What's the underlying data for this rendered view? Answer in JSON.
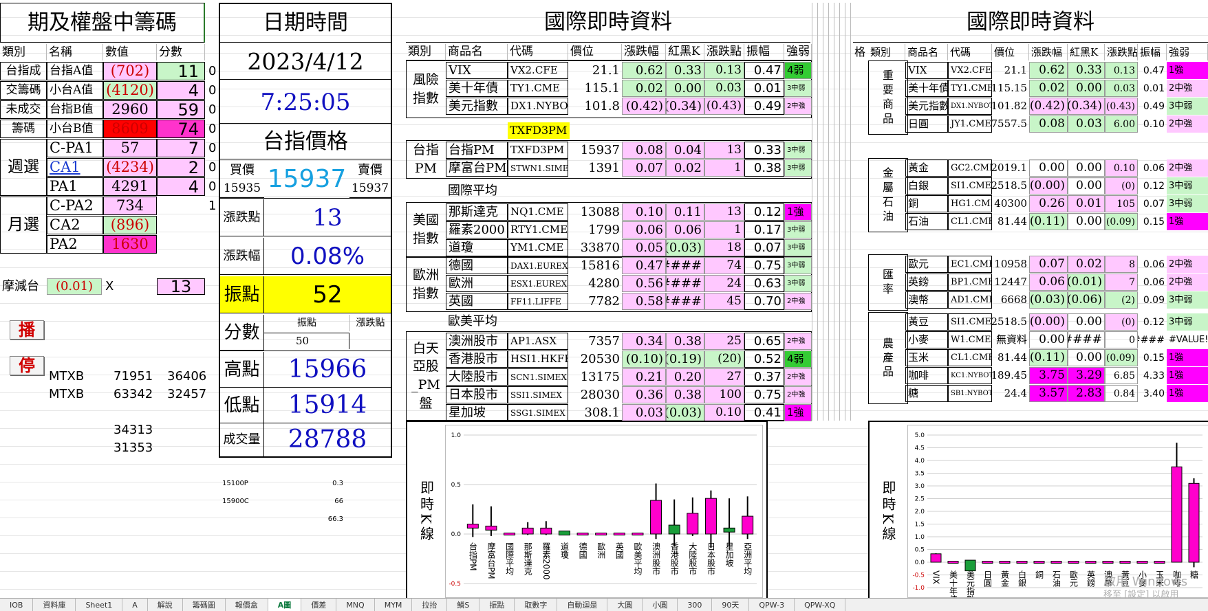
{
  "left": {
    "title": "期及權盤中籌碼",
    "headers": [
      "類別",
      "名稱",
      "數值",
      "分數"
    ],
    "rows": [
      {
        "cat": "台指成",
        "name": "台指A值",
        "val": "(702)",
        "score": "11",
        "extra": "0"
      },
      {
        "cat": "交籌碼",
        "name": "小台A值",
        "val": "(4120)",
        "score": "4",
        "extra": "0"
      },
      {
        "cat": "未成交",
        "name": "台指B值",
        "val": "2960",
        "score": "59",
        "extra": "0"
      },
      {
        "cat": "籌碼",
        "name": "小台B值",
        "val": "8609",
        "score": "74",
        "extra": "0"
      },
      {
        "cat": "",
        "name": "C-PA1",
        "val": "57",
        "score": "7",
        "extra": "0"
      },
      {
        "cat": "週選",
        "name": "CA1",
        "val": "(4234)",
        "score": "2",
        "extra": "0"
      },
      {
        "cat": "",
        "name": "PA1",
        "val": "4291",
        "score": "4",
        "extra": "0"
      },
      {
        "cat": "",
        "name": "C-PA2",
        "val": "734",
        "score": "",
        "extra": "1"
      },
      {
        "cat": "月選",
        "name": "CA2",
        "val": "(896)",
        "score": "",
        "extra": ""
      },
      {
        "cat": "",
        "name": "PA2",
        "val": "1630",
        "score": "",
        "extra": ""
      }
    ],
    "decay_label": "摩減台",
    "decay_val": "(0.01)",
    "decay_x": "X",
    "decay_score": "13",
    "play_btn": "播",
    "stop_btn": "停",
    "mtx": [
      {
        "name": "MTXB",
        "a": "71951",
        "b": "36406"
      },
      {
        "name": "MTXB",
        "a": "63342",
        "b": "32457"
      },
      {
        "name": "",
        "a": "34313",
        "b": ""
      },
      {
        "name": "",
        "a": "31353",
        "b": ""
      }
    ]
  },
  "mid": {
    "title": "日期時間",
    "date": "2023/4/12",
    "time": "7:25:05",
    "price_title": "台指價格",
    "buy_label": "買價",
    "sell_label": "賣價",
    "price": "15937",
    "buy": "15935",
    "sell": "15937",
    "chg_label": "漲跌點",
    "chg": "13",
    "pct_label": "漲跌幅",
    "pct": "0.08%",
    "amp_label": "振點",
    "amp": "52",
    "score_label": "分數",
    "score_h1": "振點",
    "score_h2": "漲跌點",
    "score_v1": "50",
    "high_label": "高點",
    "high": "15966",
    "low_label": "低點",
    "low": "15914",
    "vol_label": "成交量",
    "vol": "28788",
    "opt": [
      {
        "k": "15100P",
        "v": "0.3"
      },
      {
        "k": "15900C",
        "v": "66"
      },
      {
        "k": "",
        "v": "66.3"
      }
    ]
  },
  "intl": {
    "title": "國際即時資料",
    "headers": [
      "類別",
      "商品名",
      "代碼",
      "價位",
      "漲跌幅",
      "紅黑K",
      "漲跌點",
      "振幅",
      "強弱"
    ],
    "groups": [
      {
        "cat": "風險指數",
        "rows": [
          {
            "name": "VIX",
            "code": "VX2.CFE",
            "price": "21.1",
            "pct": "0.62",
            "k": "0.33",
            "pts": "0.13",
            "amp": "0.47",
            "str": "4弱",
            "pc": "green",
            "kc": "green",
            "ptc": "green",
            "sc": "dgreen"
          },
          {
            "name": "美十年債",
            "code": "TY1.CME",
            "price": "115.1",
            "pct": "0.02",
            "k": "0.00",
            "pts": "0.03",
            "amp": "0.01",
            "str": "3中弱",
            "pc": "green",
            "kc": "green",
            "ptc": "green",
            "sc": "green"
          },
          {
            "name": "美元指數",
            "code": "DX1.NYBOT",
            "price": "101.8",
            "pct": "(0.42)",
            "k": "(0.34)",
            "pts": "(0.43)",
            "amp": "0.49",
            "str": "2中強",
            "pc": "pink",
            "kc": "pink",
            "ptc": "pink",
            "sc": "pink"
          }
        ]
      },
      {
        "cat": "台指PM",
        "rows": [
          {
            "name": "台指PM",
            "code": "TXFD3PM",
            "price": "15937",
            "pct": "0.08",
            "k": "0.04",
            "pts": "13",
            "amp": "0.33",
            "str": "3中弱",
            "pc": "pink",
            "kc": "pink",
            "ptc": "pink",
            "sc": "green"
          },
          {
            "name": "摩富台PM",
            "code": "STWN1.SIMEX",
            "price": "1391",
            "pct": "0.07",
            "k": "0.02",
            "pts": "1",
            "amp": "0.38",
            "str": "3中弱",
            "pc": "pink",
            "kc": "pink",
            "ptc": "pink",
            "sc": "green"
          }
        ]
      },
      {
        "cat": "美國指數",
        "rows": [
          {
            "name": "那斯達克",
            "code": "NQ1.CME",
            "price": "13088",
            "pct": "0.10",
            "k": "0.11",
            "pts": "13",
            "amp": "0.12",
            "str": "1強",
            "pc": "pink",
            "kc": "pink",
            "ptc": "pink",
            "sc": "mag2"
          },
          {
            "name": "羅素2000",
            "code": "RTY1.CME",
            "price": "1799",
            "pct": "0.06",
            "k": "0.06",
            "pts": "1",
            "amp": "0.17",
            "str": "3中弱",
            "pc": "pink",
            "kc": "pink",
            "ptc": "pink",
            "sc": "green"
          },
          {
            "name": "道瓊",
            "code": "YM1.CME",
            "price": "33870",
            "pct": "0.05",
            "k": "(0.03)",
            "pts": "18",
            "amp": "0.07",
            "str": "3中弱",
            "pc": "pink",
            "kc": "green",
            "ptc": "pink",
            "sc": "green"
          }
        ]
      },
      {
        "cat": "歐洲指數",
        "rows": [
          {
            "name": "德國",
            "code": "DAX1.EUREX",
            "price": "15816",
            "pct": "0.47",
            "k": "#####",
            "pts": "74",
            "amp": "0.75",
            "str": "3中弱",
            "pc": "pink",
            "kc": "pink",
            "ptc": "pink",
            "sc": "green"
          },
          {
            "name": "歐洲",
            "code": "ESX1.EUREX",
            "price": "4280",
            "pct": "0.56",
            "k": "#####",
            "pts": "24",
            "amp": "0.63",
            "str": "3中弱",
            "pc": "pink",
            "kc": "pink",
            "ptc": "pink",
            "sc": "green"
          },
          {
            "name": "英國",
            "code": "FF11.LIFFE",
            "price": "7782",
            "pct": "0.58",
            "k": "#####",
            "pts": "45",
            "amp": "0.70",
            "str": "2中強",
            "pc": "pink",
            "kc": "pink",
            "ptc": "pink",
            "sc": "pink"
          }
        ]
      },
      {
        "cat": "白天亞股_PM盤",
        "rows": [
          {
            "name": "澳洲股市",
            "code": "AP1.ASX",
            "price": "7357",
            "pct": "0.34",
            "k": "0.38",
            "pts": "25",
            "amp": "0.65",
            "str": "2中強",
            "pc": "pink",
            "kc": "pink",
            "ptc": "pink",
            "sc": "pink"
          },
          {
            "name": "香港股市",
            "code": "HSI1.HKFE",
            "price": "20530",
            "pct": "(0.10)",
            "k": "(0.19)",
            "pts": "(20)",
            "amp": "0.52",
            "str": "4弱",
            "pc": "green",
            "kc": "green",
            "ptc": "green",
            "sc": "dgreen"
          },
          {
            "name": "大陸股市",
            "code": "SCN1.SIMEX",
            "price": "13175",
            "pct": "0.21",
            "k": "0.20",
            "pts": "27",
            "amp": "0.37",
            "str": "2中強",
            "pc": "pink",
            "kc": "pink",
            "ptc": "pink",
            "sc": "pink"
          },
          {
            "name": "日本股市",
            "code": "SSI1.SIMEX",
            "price": "28030",
            "pct": "0.36",
            "k": "0.38",
            "pts": "100",
            "amp": "0.75",
            "str": "2中強",
            "pc": "pink",
            "kc": "pink",
            "ptc": "pink",
            "sc": "pink"
          },
          {
            "name": "星加坡",
            "code": "SSG1.SIMEX",
            "price": "308.1",
            "pct": "0.03",
            "k": "(0.03)",
            "pts": "0.10",
            "amp": "0.41",
            "str": "1強",
            "pc": "pink",
            "kc": "green",
            "ptc": "pink",
            "sc": "mag2"
          }
        ]
      }
    ],
    "txf_label": "TXFD3PM",
    "intl_avg": "國際平均",
    "eu_avg": "歐美平均",
    "kline_label": "即時K線"
  },
  "intl2": {
    "title": "國際即時資料",
    "col_cut": "格",
    "groups": [
      {
        "cat": "重要商品",
        "rows": [
          {
            "name": "VIX",
            "code": "VX2.CFE",
            "price": "21.1",
            "pct": "0.62",
            "k": "0.33",
            "pts": "0.13",
            "amp": "0.47",
            "str": "1強",
            "pc": "green",
            "kc": "green",
            "ptc": "green",
            "sc": "mag2"
          },
          {
            "name": "美十年債",
            "code": "TY1.CME",
            "price": "115.15",
            "pct": "0.02",
            "k": "0.00",
            "pts": "0.03",
            "amp": "0.01",
            "str": "2中強",
            "pc": "green",
            "kc": "green",
            "ptc": "green",
            "sc": "pink"
          },
          {
            "name": "美元指數",
            "code": "DX1.NYBOT",
            "price": "101.82",
            "pct": "(0.42)",
            "k": "(0.34)",
            "pts": "(0.43)",
            "amp": "0.49",
            "str": "3中弱",
            "pc": "pink",
            "kc": "pink",
            "ptc": "pink",
            "sc": "green"
          },
          {
            "name": "日圓",
            "code": "JY1.CME",
            "price": "7557.5",
            "pct": "0.08",
            "k": "0.03",
            "pts": "6.00",
            "amp": "0.10",
            "str": "2中強",
            "pc": "green",
            "kc": "green",
            "ptc": "green",
            "sc": "pink"
          }
        ]
      },
      {
        "cat": "金屬石油",
        "rows": [
          {
            "name": "黃金",
            "code": "GC2.CME",
            "price": "2019.1",
            "pct": "0.00",
            "k": "0.00",
            "pts": "0.10",
            "amp": "0.06",
            "str": "2中強",
            "pc": "",
            "kc": "",
            "ptc": "pink",
            "sc": "pink"
          },
          {
            "name": "白銀",
            "code": "SI1.CME",
            "price": "2518.5",
            "pct": "(0.00)",
            "k": "0.00",
            "pts": "(0)",
            "amp": "0.12",
            "str": "3中弱",
            "pc": "pink",
            "kc": "",
            "ptc": "pink",
            "sc": "green"
          },
          {
            "name": "銅",
            "code": "HG1.CME",
            "price": "40300",
            "pct": "0.26",
            "k": "0.01",
            "pts": "105",
            "amp": "0.07",
            "str": "3中弱",
            "pc": "pink",
            "kc": "pink",
            "ptc": "pink",
            "sc": "green"
          },
          {
            "name": "石油",
            "code": "CL1.CME",
            "price": "81.44",
            "pct": "(0.11)",
            "k": "0.00",
            "pts": "(0.09)",
            "amp": "0.15",
            "str": "1強",
            "pc": "green",
            "kc": "",
            "ptc": "green",
            "sc": "mag2"
          }
        ]
      },
      {
        "cat": "匯率",
        "rows": [
          {
            "name": "歐元",
            "code": "EC1.CME",
            "price": "10958",
            "pct": "0.07",
            "k": "0.02",
            "pts": "8",
            "amp": "0.06",
            "str": "2中強",
            "pc": "pink",
            "kc": "pink",
            "ptc": "pink",
            "sc": "pink"
          },
          {
            "name": "英鎊",
            "code": "BP1.CME",
            "price": "12447",
            "pct": "0.06",
            "k": "(0.01)",
            "pts": "7",
            "amp": "0.06",
            "str": "2中強",
            "pc": "pink",
            "kc": "green",
            "ptc": "pink",
            "sc": "pink"
          },
          {
            "name": "澳幣",
            "code": "AD1.CME",
            "price": "6668",
            "pct": "(0.03)",
            "k": "(0.06)",
            "pts": "(2)",
            "amp": "0.09",
            "str": "3中弱",
            "pc": "green",
            "kc": "green",
            "ptc": "green",
            "sc": "green"
          }
        ]
      },
      {
        "cat": "農產品",
        "rows": [
          {
            "name": "黃豆",
            "code": "SI1.CME",
            "price": "2518.5",
            "pct": "(0.00)",
            "k": "0.00",
            "pts": "(0)",
            "amp": "0.12",
            "str": "3中弱",
            "pc": "pink",
            "kc": "",
            "ptc": "pink",
            "sc": "green"
          },
          {
            "name": "小麥",
            "code": "W1.CME",
            "price": "無資料",
            "pct": "0.00",
            "k": "#####",
            "pts": "0",
            "amp": "####",
            "str": "#VALUE!",
            "pc": "",
            "kc": "",
            "ptc": "",
            "sc": ""
          },
          {
            "name": "玉米",
            "code": "CL1.CME",
            "price": "81.44",
            "pct": "(0.11)",
            "k": "0.00",
            "pts": "(0.09)",
            "amp": "0.15",
            "str": "1強",
            "pc": "green",
            "kc": "",
            "ptc": "green",
            "sc": "mag2"
          },
          {
            "name": "咖啡",
            "code": "KC1.NYBOT",
            "price": "189.45",
            "pct": "3.75",
            "k": "3.29",
            "pts": "6.85",
            "amp": "4.33",
            "str": "1強",
            "pc": "mag2",
            "kc": "mag2",
            "ptc": "",
            "sc": "mag2"
          },
          {
            "name": "糖",
            "code": "SB1.NYBOT",
            "price": "24.4",
            "pct": "3.57",
            "k": "2.83",
            "pts": "0.84",
            "amp": "3.40",
            "str": "1強",
            "pc": "mag2",
            "kc": "mag2",
            "ptc": "",
            "sc": "mag2"
          }
        ]
      }
    ],
    "kline_label": "即時K線"
  },
  "chart_data": [
    {
      "type": "bar",
      "categories": [
        "台指PM",
        "摩富台PM",
        "國際平均",
        "那斯達克",
        "羅素2000",
        "道瓊",
        "德國",
        "歐洲",
        "英國",
        "歐美平均",
        "澳洲股市",
        "香港股市",
        "大陸股市",
        "日本股市",
        "星加坡",
        "亞洲平均"
      ],
      "open": [
        0.06,
        0.05,
        0.0,
        0.0,
        0.0,
        0.02,
        0.0,
        0.0,
        0.0,
        0.0,
        0.0,
        0.09,
        0.0,
        0.0,
        0.05,
        0.0
      ],
      "close": [
        0.1,
        0.07,
        0.0,
        0.06,
        0.06,
        0.0,
        0.0,
        0.0,
        0.0,
        0.0,
        0.34,
        0.0,
        0.21,
        0.36,
        0.03,
        0.18
      ],
      "high": [
        0.3,
        0.28,
        0.0,
        0.12,
        0.13,
        0.03,
        0.0,
        0.0,
        0.0,
        0.0,
        0.51,
        0.35,
        0.37,
        0.44,
        0.36,
        0.38
      ],
      "low": [
        -0.03,
        -0.02,
        0.0,
        -0.01,
        -0.01,
        -0.01,
        0.0,
        0.0,
        0.0,
        0.0,
        -0.05,
        -0.12,
        -0.02,
        -0.14,
        -0.12,
        -0.05
      ],
      "up": [
        true,
        true,
        true,
        true,
        true,
        false,
        true,
        true,
        true,
        true,
        true,
        false,
        true,
        true,
        false,
        true
      ],
      "ylim": [
        -0.5,
        1.0
      ],
      "yticks": [
        -0.5,
        0.0,
        0.5,
        1.0
      ],
      "grid": true
    },
    {
      "type": "bar",
      "categories": [
        "VIX",
        "美十年債",
        "美元指數",
        "日圓",
        "黃金",
        "白銀",
        "銅",
        "石油",
        "歐元",
        "英鎊",
        "澳幣",
        "黃豆",
        "小麥",
        "玉米",
        "咖啡",
        "糖"
      ],
      "open": [
        0.0,
        0.0,
        0.08,
        0.0,
        0.0,
        0.0,
        0.0,
        0.0,
        0.0,
        0.0,
        0.0,
        0.0,
        0.0,
        0.0,
        0.0,
        0.0
      ],
      "close": [
        0.33,
        0.0,
        -0.34,
        0.0,
        0.0,
        0.0,
        0.0,
        0.0,
        0.0,
        0.0,
        0.0,
        0.0,
        0.0,
        0.0,
        3.75,
        3.1
      ],
      "high": [
        0.35,
        0.0,
        0.08,
        0.02,
        0.02,
        0.02,
        0.02,
        0.02,
        0.02,
        0.02,
        0.02,
        0.02,
        0.0,
        0.02,
        4.7,
        3.3
      ],
      "low": [
        0.0,
        0.0,
        -0.36,
        -0.02,
        -0.02,
        -0.02,
        -0.02,
        -0.02,
        -0.02,
        -0.02,
        -0.02,
        -0.02,
        0.0,
        -0.02,
        0.0,
        -0.2
      ],
      "up": [
        true,
        true,
        false,
        true,
        true,
        true,
        true,
        true,
        true,
        true,
        true,
        true,
        true,
        true,
        true,
        true
      ],
      "ylim": [
        -1.0,
        5.0
      ],
      "yticks": [
        -1.0,
        -0.5,
        0.0,
        0.5,
        1.0,
        1.5,
        2.0,
        2.5,
        3.0,
        3.5,
        4.0,
        4.5,
        5.0
      ],
      "grid": true
    }
  ],
  "tabs": [
    "IOB",
    "資料庫",
    "Sheet1",
    "A",
    "解說",
    "籌碼圖",
    "報價盒",
    "A圖",
    "價差",
    "MNQ",
    "MYM",
    "拉抬",
    "鱗S",
    "振點",
    "取數字",
    "自動迴是",
    "大圓",
    "小圓",
    "300",
    "90天",
    "QPW-3",
    "QPW-XQ"
  ],
  "active_tab": "A圖",
  "watermark": {
    "line1": "啟用 Windows",
    "line2": "移至 [設定] 以啟用 Windows"
  }
}
